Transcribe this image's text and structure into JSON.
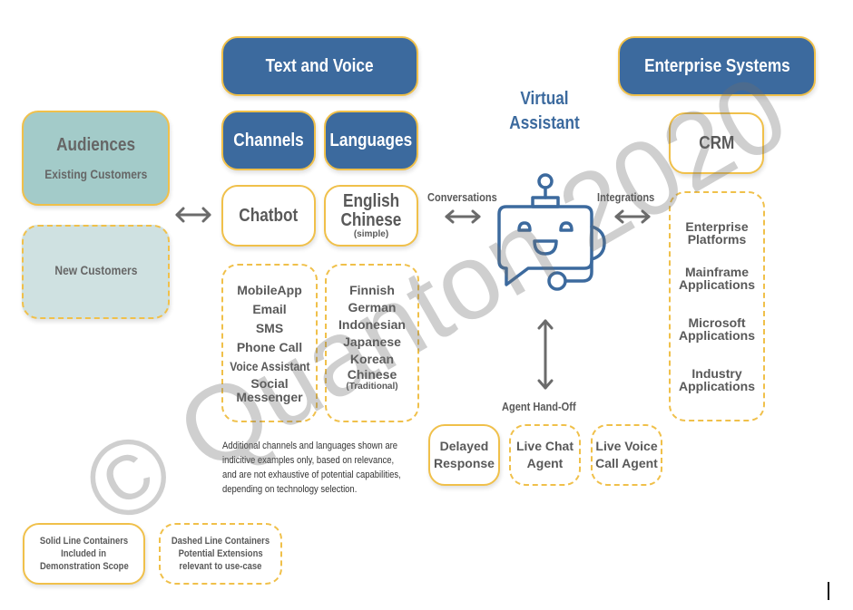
{
  "header": {
    "text_and_voice": "Text and Voice",
    "enterprise_systems": "Enterprise Systems",
    "virtual_assistant_line1": "Virtual",
    "virtual_assistant_line2": "Assistant"
  },
  "audiences": {
    "title": "Audiences",
    "existing": "Existing Customers",
    "new": "New Customers"
  },
  "channels": {
    "title": "Channels",
    "primary": "Chatbot",
    "extensions": [
      "MobileApp",
      "Email",
      "SMS",
      "Phone Call",
      "Voice Assistant",
      "Social",
      "Messenger"
    ]
  },
  "languages": {
    "title": "Languages",
    "primary_line1": "English",
    "primary_line2": "Chinese",
    "primary_note": "(simple)",
    "extensions": [
      "Finnish",
      "German",
      "Indonesian",
      "Japanese",
      "Korean",
      "Chinese"
    ],
    "extensions_note": "(Traditional)"
  },
  "connectors": {
    "conversations": "Conversations",
    "integrations": "Integrations",
    "agent_handoff": "Agent Hand-Off"
  },
  "enterprise": {
    "crm": "CRM",
    "items": [
      [
        "Enterprise",
        "Platforms"
      ],
      [
        "Mainframe",
        "Applications"
      ],
      [
        "Microsoft",
        "Applications"
      ],
      [
        "Industry",
        "Applications"
      ]
    ]
  },
  "agents": {
    "delayed": [
      "Delayed",
      "Response"
    ],
    "live_chat": [
      "Live Chat",
      "Agent"
    ],
    "live_voice": [
      "Live Voice",
      "Call Agent"
    ]
  },
  "note": [
    "Additional channels and languages shown are",
    "indicitive examples only, based on relevance,",
    "and are not exhaustive of potential capabilities,",
    "depending on technology selection."
  ],
  "legend": {
    "solid_title": "Solid Line Containers",
    "solid_line1": "Included in",
    "solid_line2": "Demonstration Scope",
    "dashed_title": "Dashed Line Containers",
    "dashed_line1": "Potential Extensions",
    "dashed_line2": "relevant to use-case"
  },
  "watermark": "© Quanton 2020",
  "colors": {
    "navy": "#3c6a9e",
    "gold": "#f0c04a",
    "teal": "#a3cbc9",
    "teal_light": "#cfe1e1",
    "arrow": "#6b6b6b",
    "text": "#595959"
  }
}
